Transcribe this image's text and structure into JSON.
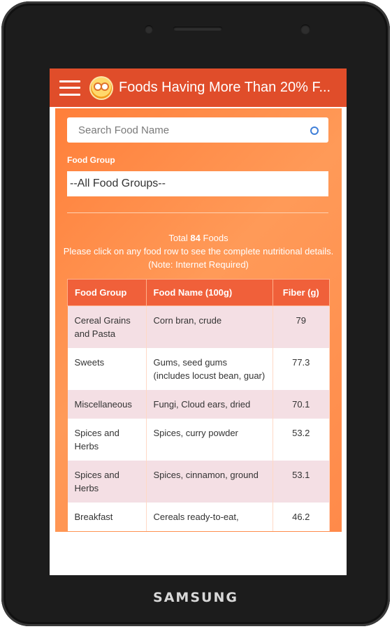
{
  "device": {
    "brand": "SAMSUNG"
  },
  "app_bar": {
    "title": "Foods Having More Than 20% F..."
  },
  "search": {
    "placeholder": "Search Food Name",
    "value": ""
  },
  "filter": {
    "label": "Food Group",
    "selected": "--All Food Groups--"
  },
  "summary": {
    "prefix": "Total ",
    "count": "84",
    "suffix": " Foods",
    "instruction": "Please click on any food row to see the complete nutritional details. (Note: Internet Required)"
  },
  "table": {
    "headers": [
      "Food Group",
      "Food Name (100g)",
      "Fiber (g)"
    ],
    "rows": [
      {
        "group": "Cereal Grains and Pasta",
        "name": "Corn bran, crude",
        "fiber": "79"
      },
      {
        "group": "Sweets",
        "name": "Gums, seed gums (includes locust bean, guar)",
        "fiber": "77.3"
      },
      {
        "group": "Miscellaneous",
        "name": "Fungi, Cloud ears, dried",
        "fiber": "70.1"
      },
      {
        "group": "Spices and Herbs",
        "name": "Spices, curry powder",
        "fiber": "53.2"
      },
      {
        "group": "Spices and Herbs",
        "name": "Spices, cinnamon, ground",
        "fiber": "53.1"
      },
      {
        "group": "Breakfast",
        "name": "Cereals ready-to-eat,",
        "fiber": "46.2"
      }
    ]
  },
  "colors": {
    "app_bar": "#e04d2a",
    "background": "#ff8a4a",
    "header_row": "#f0603a",
    "alt_row": "#f4dfe4"
  },
  "icons": {
    "menu": "hamburger-menu-icon",
    "logo": "app-logo-icon",
    "search": "search-icon"
  }
}
